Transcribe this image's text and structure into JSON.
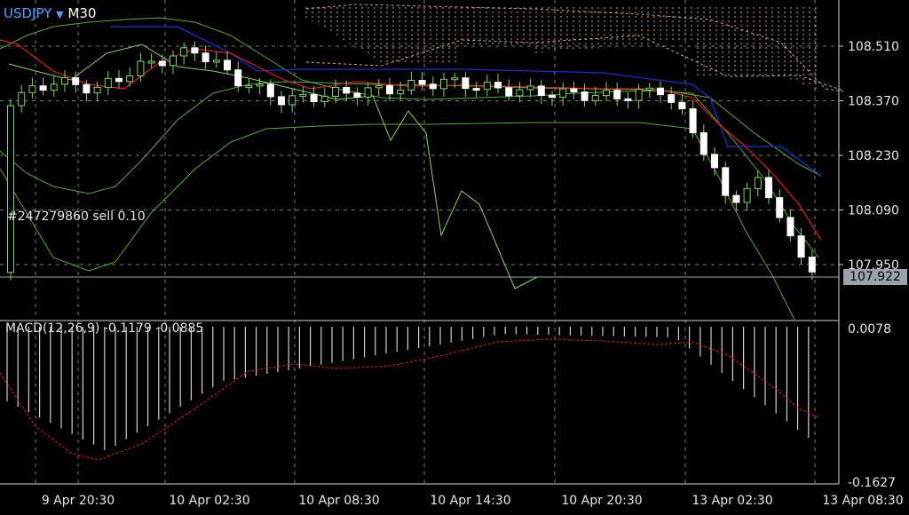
{
  "header": {
    "symbol": "USDJPY",
    "dropdown_icon": "▼",
    "timeframe": "M30"
  },
  "trade_label": "#247279860 sell 0.10",
  "current_price": "107.922",
  "price_axis_labels": [
    "108.510",
    "108.370",
    "108.230",
    "108.090",
    "107.950"
  ],
  "macd": {
    "label": "MACD(12,26,9) -0.1179 -0.0885",
    "axis_top": "0.0078",
    "axis_bottom": "-0.1627"
  },
  "time_labels": [
    "9 Apr 20:30",
    "10 Apr 02:30",
    "10 Apr 08:30",
    "10 Apr 14:30",
    "10 Apr 20:30",
    "13 Apr 02:30",
    "13 Apr 08:30"
  ],
  "colors": {
    "background": "#000000",
    "grid": "#7a7a7a",
    "bull_candle": "#ffffff",
    "wick": "#7fd860",
    "ma_blue": "#1a2fd0",
    "ma_red": "#e0201a",
    "bands_green": "#6fbf4a",
    "ichimoku": "#d9a080",
    "macd_hist": "#cfcfcf",
    "macd_signal": "#e02020",
    "price_tag": "#9aa3ad"
  },
  "chart_data": [
    {
      "type": "candlestick",
      "title": "USDJPY M30",
      "x": [
        "9 Apr 20:30",
        "10 Apr 02:30",
        "10 Apr 08:30",
        "10 Apr 14:30",
        "10 Apr 20:30",
        "13 Apr 02:30",
        "13 Apr 08:30"
      ],
      "close": [
        108.36,
        108.4,
        108.49,
        108.42,
        108.36,
        108.38,
        108.42,
        108.44,
        108.4,
        108.38,
        108.34,
        108.33,
        108.34,
        108.36,
        108.34,
        108.14,
        108.03,
        107.922
      ],
      "ylim": [
        107.83,
        108.63
      ],
      "grid": true
    },
    {
      "type": "bar",
      "title": "MACD(12,26,9)",
      "values": [
        -0.1179,
        -0.0885
      ],
      "ylim": [
        -0.1627,
        0.0078
      ]
    }
  ]
}
